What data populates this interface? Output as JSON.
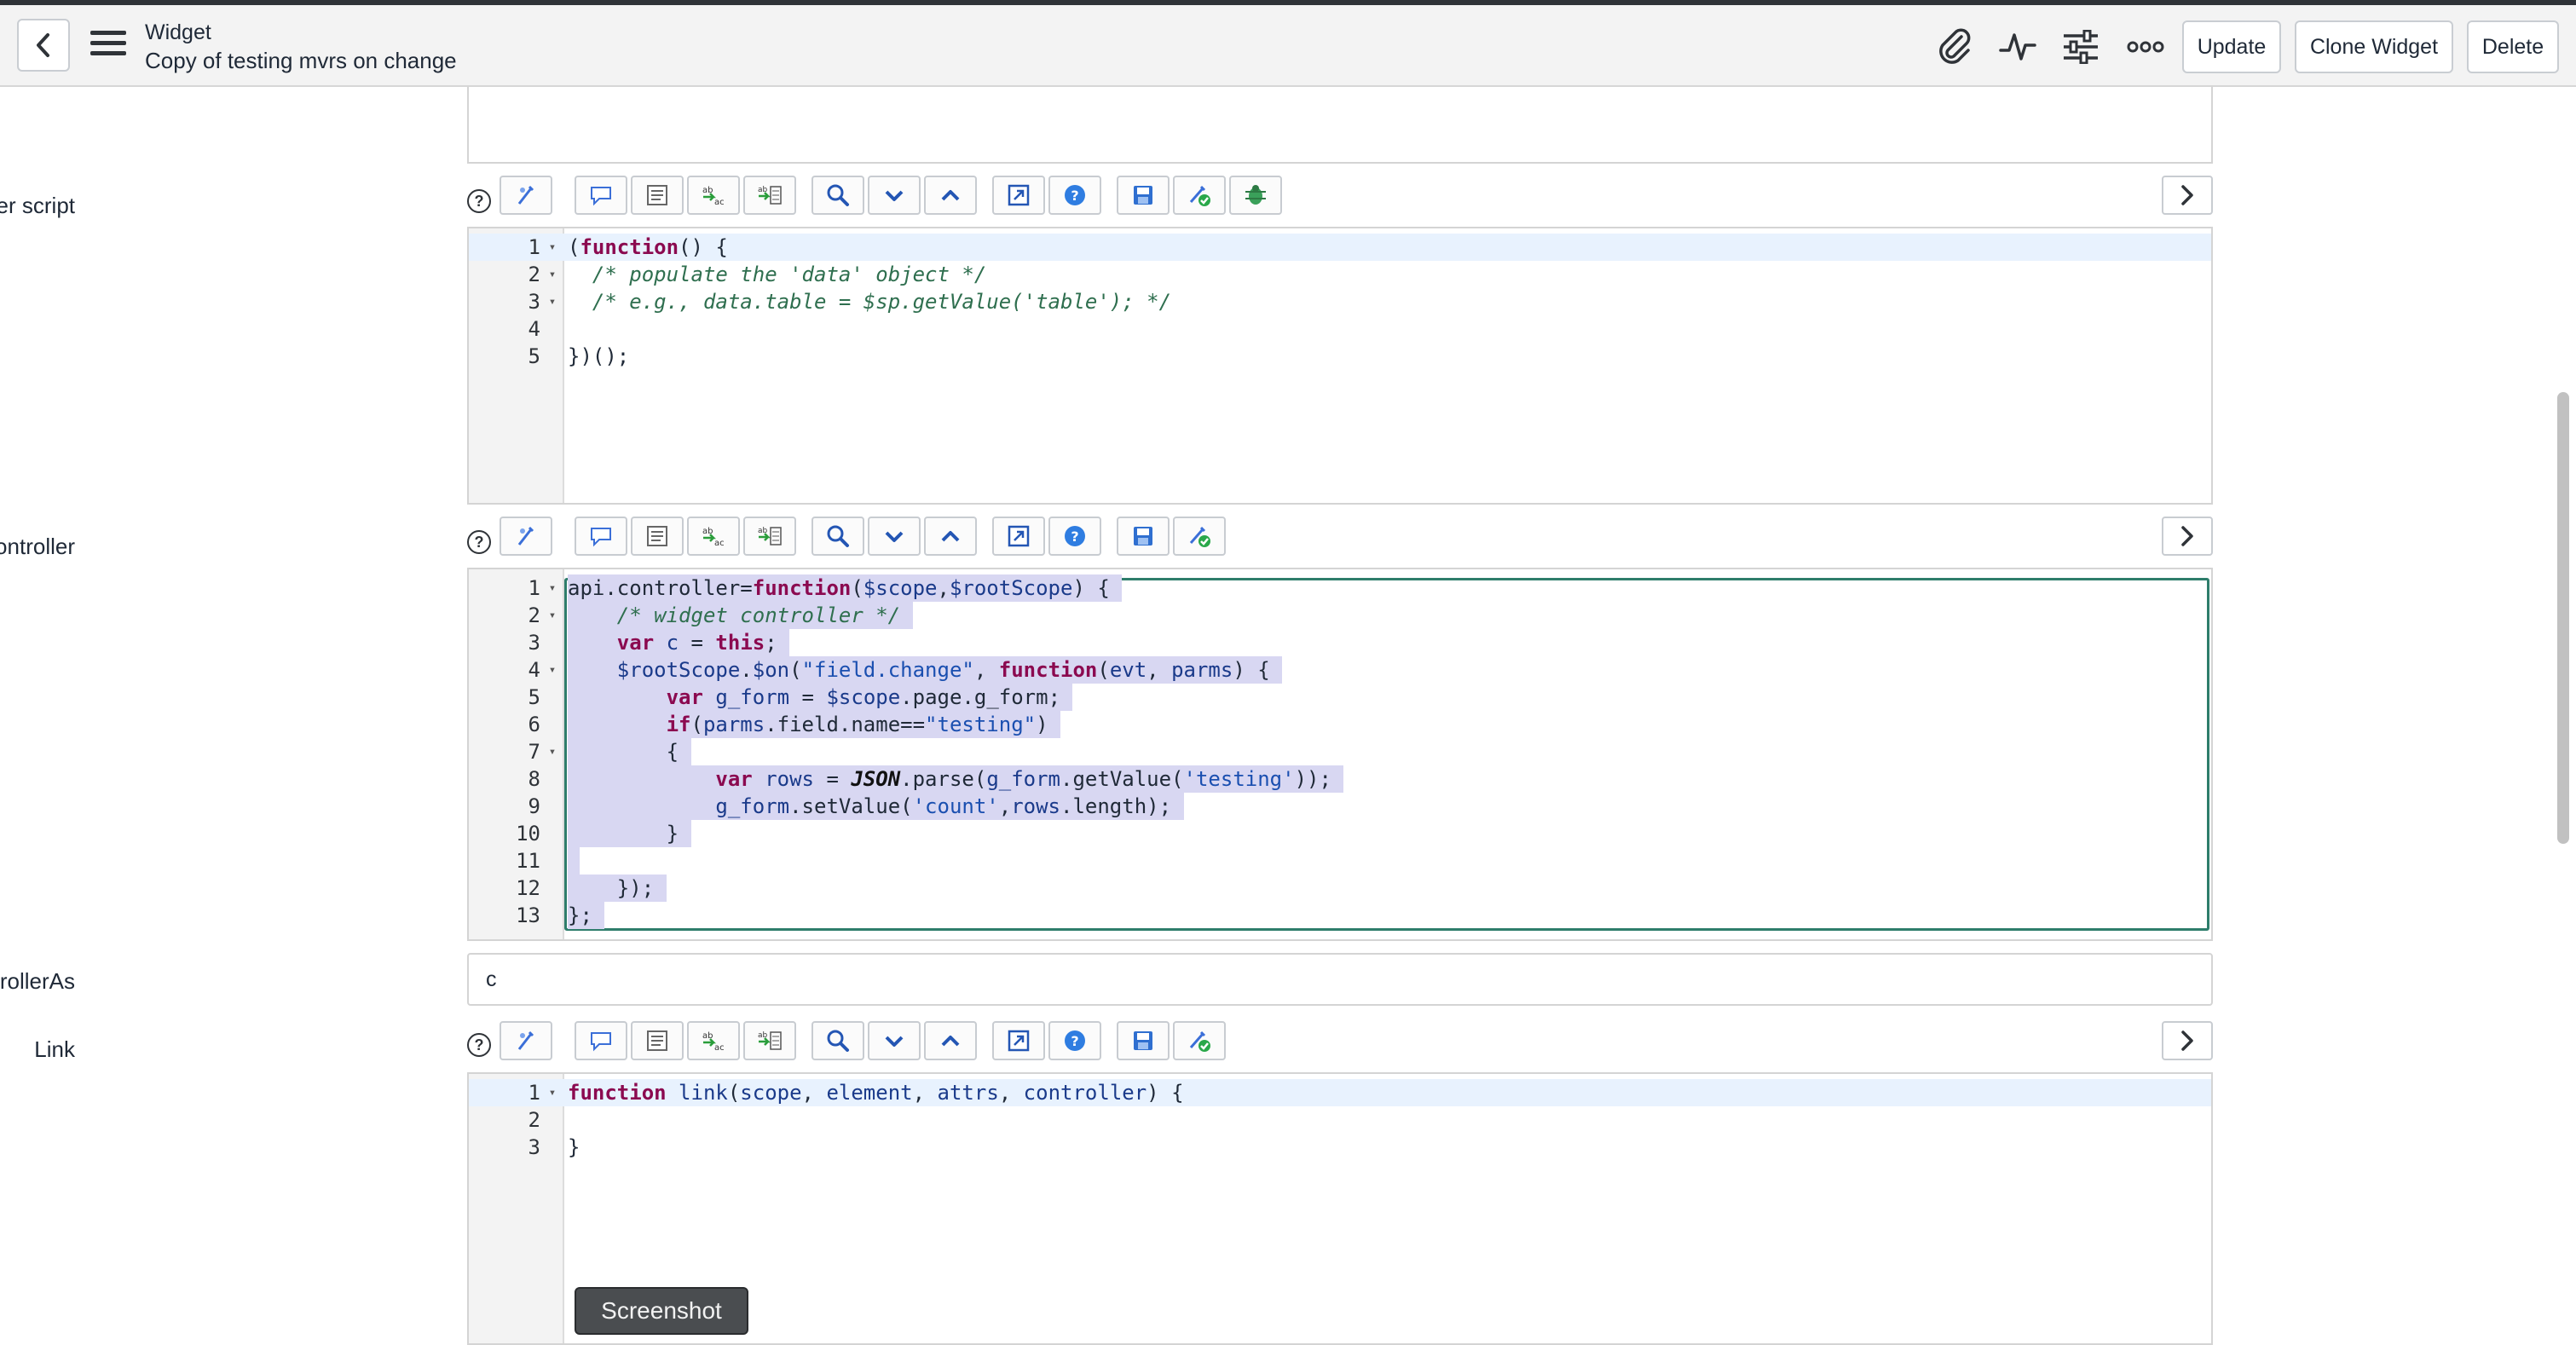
{
  "header": {
    "title": "Widget",
    "subtitle": "Copy of testing mvrs on change",
    "back_icon": "chevron-left-icon",
    "menu_icon": "hamburger-menu-icon",
    "icons": [
      "paperclip-icon",
      "activity-icon",
      "sliders-icon",
      "more-options-icon"
    ],
    "update_label": "Update",
    "clone_label": "Clone Widget",
    "delete_label": "Delete"
  },
  "toolbar_icons": [
    "script-assist-icon",
    "toggle-comment-icon",
    "format-code-icon",
    "replace-icon",
    "replace-all-icon",
    "search-icon",
    "find-next-icon",
    "find-previous-icon",
    "fullscreen-icon",
    "help-icon",
    "save-icon",
    "syntax-check-icon",
    "debug-icon"
  ],
  "sections": {
    "server_script": {
      "label": "Server script",
      "lines": [
        {
          "n": "1",
          "fold": true,
          "code": "(function() {"
        },
        {
          "n": "2",
          "fold": true,
          "code": "  /* populate the 'data' object */"
        },
        {
          "n": "3",
          "fold": true,
          "code": "  /* e.g., data.table = $sp.getValue('table'); */"
        },
        {
          "n": "4",
          "fold": false,
          "code": ""
        },
        {
          "n": "5",
          "fold": false,
          "code": "})();"
        }
      ]
    },
    "client_controller": {
      "label": "Client controller",
      "lines": [
        {
          "n": "1",
          "fold": true,
          "code": "api.controller=function($scope,$rootScope) {"
        },
        {
          "n": "2",
          "fold": true,
          "code": "    /* widget controller */"
        },
        {
          "n": "3",
          "fold": false,
          "code": "    var c = this;"
        },
        {
          "n": "4",
          "fold": true,
          "code": "    $rootScope.$on(\"field.change\", function(evt, parms) {"
        },
        {
          "n": "5",
          "fold": false,
          "code": "        var g_form = $scope.page.g_form;"
        },
        {
          "n": "6",
          "fold": false,
          "code": "        if(parms.field.name==\"testing\")"
        },
        {
          "n": "7",
          "fold": true,
          "code": "        {"
        },
        {
          "n": "8",
          "fold": false,
          "code": "            var rows = JSON.parse(g_form.getValue('testing'));"
        },
        {
          "n": "9",
          "fold": false,
          "code": "            g_form.setValue('count',rows.length);"
        },
        {
          "n": "10",
          "fold": false,
          "code": "        }"
        },
        {
          "n": "11",
          "fold": false,
          "code": ""
        },
        {
          "n": "12",
          "fold": false,
          "code": "    });"
        },
        {
          "n": "13",
          "fold": false,
          "code": "};"
        }
      ]
    },
    "controller_as": {
      "label": "controllerAs",
      "value": "c"
    },
    "link": {
      "label": "Link",
      "lines": [
        {
          "n": "1",
          "fold": true,
          "code": "function link(scope, element, attrs, controller) {"
        },
        {
          "n": "2",
          "fold": false,
          "code": ""
        },
        {
          "n": "3",
          "fold": false,
          "code": "}"
        }
      ]
    }
  },
  "tooltip": "Screenshot",
  "colors": {
    "selection": "#d8d7f2",
    "focus_border": "#2e7d6b",
    "keyword": "#8b0a50",
    "variable": "#1a3a8a",
    "string": "#1a4fb0",
    "comment": "#2f6f4f"
  }
}
